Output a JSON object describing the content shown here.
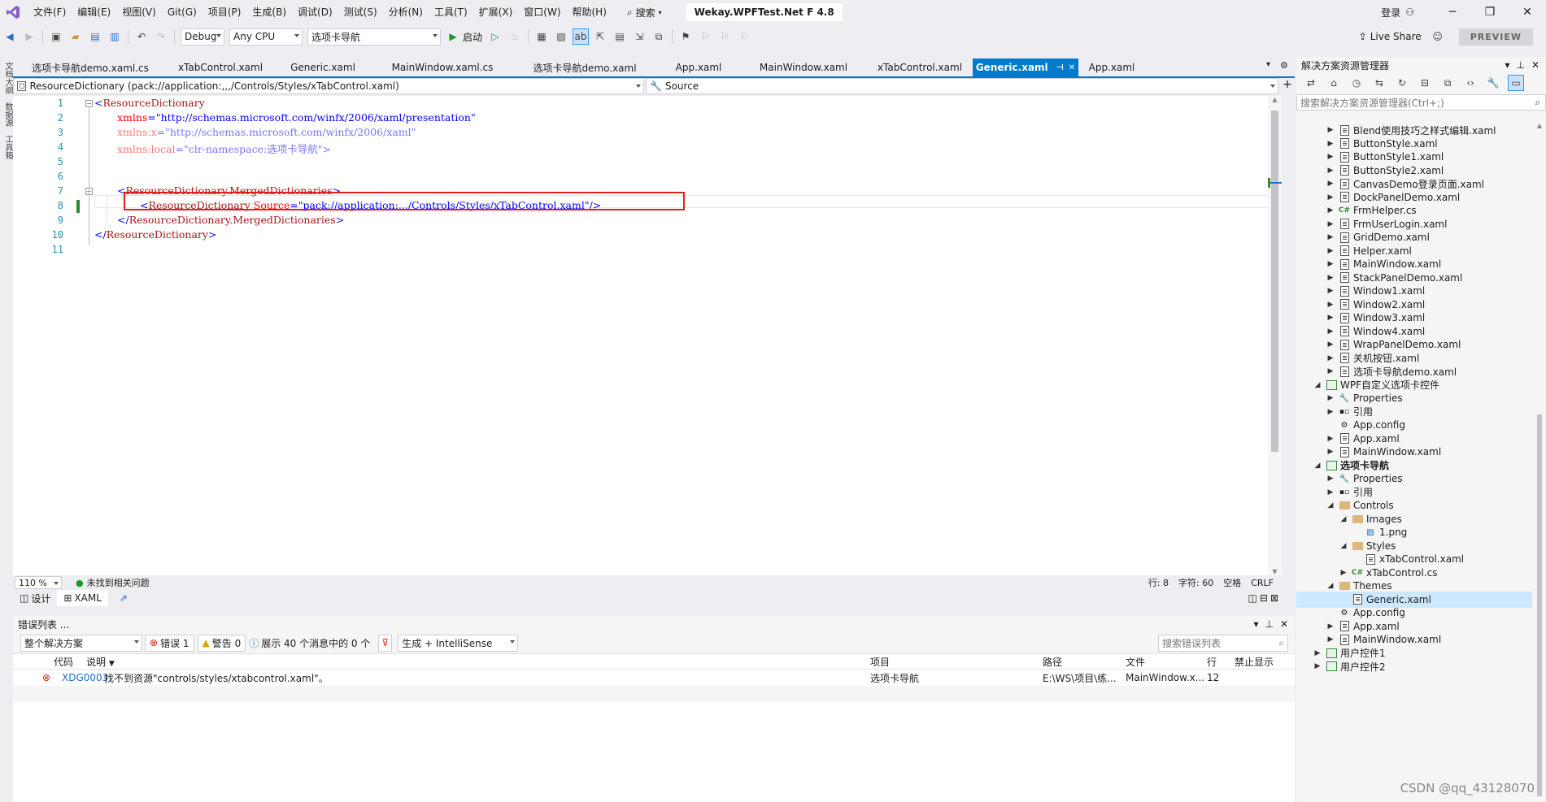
{
  "menu": {
    "items": [
      "文件(F)",
      "编辑(E)",
      "视图(V)",
      "Git(G)",
      "项目(P)",
      "生成(B)",
      "调试(D)",
      "测试(S)",
      "分析(N)",
      "工具(T)",
      "扩展(X)",
      "窗口(W)",
      "帮助(H)"
    ],
    "search": "搜索",
    "solution_name": "Wekay.WPFTest.Net F 4.8",
    "login": "登录"
  },
  "toolbar": {
    "config": "Debug",
    "platform": "Any CPU",
    "startup_project": "选项卡导航",
    "start_label": "启动",
    "live_share": "Live Share",
    "preview": "PREVIEW"
  },
  "left_strip": [
    "文档大纲",
    "数据源",
    "工具箱"
  ],
  "tabs": [
    {
      "label": "选项卡导航demo.xaml.cs"
    },
    {
      "label": "xTabControl.xaml"
    },
    {
      "label": "Generic.xaml"
    },
    {
      "label": "MainWindow.xaml.cs"
    },
    {
      "label": "选项卡导航demo.xaml"
    },
    {
      "label": "App.xaml"
    },
    {
      "label": "MainWindow.xaml"
    },
    {
      "label": "xTabControl.xaml"
    },
    {
      "label": "Generic.xaml",
      "active": true
    },
    {
      "label": "App.xaml"
    }
  ],
  "navbar": {
    "left": "ResourceDictionary (pack://application:,,,/Controls/Styles/xTabControl.xaml)",
    "right": "Source"
  },
  "code": {
    "line_numbers": [
      "1",
      "2",
      "3",
      "4",
      "5",
      "6",
      "7",
      "8",
      "9",
      "10",
      "11"
    ],
    "l1_tag": "ResourceDictionary",
    "l2_attr": "xmlns",
    "l2_val": "\"http://schemas.microsoft.com/winfx/2006/xaml/presentation\"",
    "l3_attr": "xmlns:x",
    "l3_val": "\"http://schemas.microsoft.com/winfx/2006/xaml\"",
    "l4_attr": "xmlns:local",
    "l4_val": "\"clr-namespace:选项卡导航\"",
    "l7_tag": "ResourceDictionary.MergedDictionaries",
    "l8_tag": "ResourceDictionary",
    "l8_attr": "Source",
    "l8_val": "\"pack://application:,,,/Controls/Styles/xTabControl.xaml\"",
    "l9_tag": "ResourceDictionary.MergedDictionaries",
    "l10_tag": "ResourceDictionary"
  },
  "editor_status": {
    "zoom": "110 %",
    "issues": "未找到相关问题",
    "line": "行: 8",
    "char": "字符: 60",
    "whitespace": "空格",
    "eol": "CRLF"
  },
  "view_tabs": {
    "design": "设计",
    "xaml": "XAML"
  },
  "error_list": {
    "title": "错误列表 ...",
    "scope": "整个解决方案",
    "errors": "错误 1",
    "warnings": "警告 0",
    "messages": "展示 40 个消息中的 0 个",
    "build_filter": "生成 + IntelliSense",
    "search_placeholder": "搜索错误列表",
    "columns": [
      "代码",
      "说明",
      "项目",
      "文件",
      "路径",
      "行",
      "禁止显示"
    ],
    "rows": [
      {
        "code": "XDG0003",
        "description": "找不到资源\"controls/styles/xtabcontrol.xaml\"。",
        "project": "选项卡导航",
        "path": "E:\\WS\\项目\\练...",
        "file": "MainWindow.x...",
        "line": "12"
      }
    ]
  },
  "solution_explorer": {
    "title": "解决方案资源管理器",
    "search_placeholder": "搜索解决方案资源管理器(Ctrl+;)",
    "items": [
      {
        "label": "Blend使用技巧之样式编辑.xaml",
        "indent": 2,
        "exp": "▶",
        "icon": "xaml"
      },
      {
        "label": "ButtonStyle.xaml",
        "indent": 2,
        "exp": "▶",
        "icon": "xaml"
      },
      {
        "label": "ButtonStyle1.xaml",
        "indent": 2,
        "exp": "▶",
        "icon": "xaml"
      },
      {
        "label": "ButtonStyle2.xaml",
        "indent": 2,
        "exp": "▶",
        "icon": "xaml"
      },
      {
        "label": "CanvasDemo登录页面.xaml",
        "indent": 2,
        "exp": "▶",
        "icon": "xaml"
      },
      {
        "label": "DockPanelDemo.xaml",
        "indent": 2,
        "exp": "▶",
        "icon": "xaml"
      },
      {
        "label": "FrmHelper.cs",
        "indent": 2,
        "exp": "▶",
        "icon": "cs"
      },
      {
        "label": "FrmUserLogin.xaml",
        "indent": 2,
        "exp": "▶",
        "icon": "xaml"
      },
      {
        "label": "GridDemo.xaml",
        "indent": 2,
        "exp": "▶",
        "icon": "xaml"
      },
      {
        "label": "Helper.xaml",
        "indent": 2,
        "exp": "▶",
        "icon": "xaml"
      },
      {
        "label": "MainWindow.xaml",
        "indent": 2,
        "exp": "▶",
        "icon": "xaml"
      },
      {
        "label": "StackPanelDemo.xaml",
        "indent": 2,
        "exp": "▶",
        "icon": "xaml"
      },
      {
        "label": "Window1.xaml",
        "indent": 2,
        "exp": "▶",
        "icon": "xaml"
      },
      {
        "label": "Window2.xaml",
        "indent": 2,
        "exp": "▶",
        "icon": "xaml"
      },
      {
        "label": "Window3.xaml",
        "indent": 2,
        "exp": "▶",
        "icon": "xaml"
      },
      {
        "label": "Window4.xaml",
        "indent": 2,
        "exp": "▶",
        "icon": "xaml"
      },
      {
        "label": "WrapPanelDemo.xaml",
        "indent": 2,
        "exp": "▶",
        "icon": "xaml"
      },
      {
        "label": "关机按钮.xaml",
        "indent": 2,
        "exp": "▶",
        "icon": "xaml"
      },
      {
        "label": "选项卡导航demo.xaml",
        "indent": 2,
        "exp": "▶",
        "icon": "xaml"
      },
      {
        "label": "WPF自定义选项卡控件",
        "indent": 1,
        "exp": "◢",
        "icon": "proj"
      },
      {
        "label": "Properties",
        "indent": 2,
        "exp": "▶",
        "icon": "wrench"
      },
      {
        "label": "引用",
        "indent": 2,
        "exp": "▶",
        "icon": "ref"
      },
      {
        "label": "App.config",
        "indent": 2,
        "exp": "",
        "icon": "config"
      },
      {
        "label": "App.xaml",
        "indent": 2,
        "exp": "▶",
        "icon": "xaml"
      },
      {
        "label": "MainWindow.xaml",
        "indent": 2,
        "exp": "▶",
        "icon": "xaml"
      },
      {
        "label": "选项卡导航",
        "indent": 1,
        "exp": "◢",
        "icon": "proj",
        "bold": true
      },
      {
        "label": "Properties",
        "indent": 2,
        "exp": "▶",
        "icon": "wrench"
      },
      {
        "label": "引用",
        "indent": 2,
        "exp": "▶",
        "icon": "ref"
      },
      {
        "label": "Controls",
        "indent": 2,
        "exp": "◢",
        "icon": "folder"
      },
      {
        "label": "Images",
        "indent": 3,
        "exp": "◢",
        "icon": "folder"
      },
      {
        "label": "1.png",
        "indent": 4,
        "exp": "",
        "icon": "img"
      },
      {
        "label": "Styles",
        "indent": 3,
        "exp": "◢",
        "icon": "folder"
      },
      {
        "label": "xTabControl.xaml",
        "indent": 4,
        "exp": "",
        "icon": "xaml"
      },
      {
        "label": "xTabControl.cs",
        "indent": 3,
        "exp": "▶",
        "icon": "cs"
      },
      {
        "label": "Themes",
        "indent": 2,
        "exp": "◢",
        "icon": "folder"
      },
      {
        "label": "Generic.xaml",
        "indent": 3,
        "exp": "",
        "icon": "xaml",
        "selected": true
      },
      {
        "label": "App.config",
        "indent": 2,
        "exp": "",
        "icon": "config"
      },
      {
        "label": "App.xaml",
        "indent": 2,
        "exp": "▶",
        "icon": "xaml"
      },
      {
        "label": "MainWindow.xaml",
        "indent": 2,
        "exp": "▶",
        "icon": "xaml"
      },
      {
        "label": "用户控件1",
        "indent": 1,
        "exp": "▶",
        "icon": "proj"
      },
      {
        "label": "用户控件2",
        "indent": 1,
        "exp": "▶",
        "icon": "proj"
      }
    ]
  },
  "watermark": "CSDN @qq_43128070"
}
